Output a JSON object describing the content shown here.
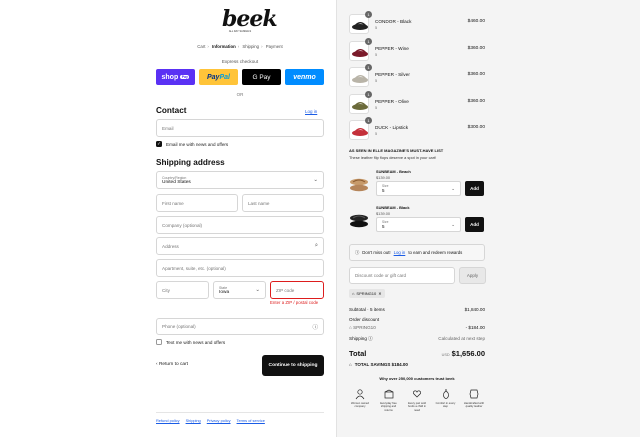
{
  "logo": {
    "text": "beek",
    "sub": "ALL DAY SANDALS"
  },
  "breadcrumbs": [
    "Cart",
    "Information",
    "Shipping",
    "Payment"
  ],
  "express_checkout": "Express checkout",
  "express_buttons": {
    "shop": "shop",
    "shop_pill": "Pay",
    "paypal_a": "Pay",
    "paypal_b": "Pal",
    "gpay": "G Pay",
    "venmo": "venmo"
  },
  "or": "OR",
  "contact": {
    "heading": "Contact",
    "login": "Log in",
    "email_placeholder": "Email",
    "news_label": "Email me with news and offers"
  },
  "shipping": {
    "heading": "Shipping address",
    "country_label": "Country/Region",
    "country_value": "United States",
    "first_name": "First name",
    "last_name": "Last name",
    "company": "Company (optional)",
    "address": "Address",
    "apartment": "Apartment, suite, etc. (optional)",
    "city": "City",
    "state_label": "State",
    "state_value": "Iowa",
    "zip": "ZIP code",
    "zip_error": "Enter a ZIP / postal code",
    "phone": "Phone (optional)",
    "text_label": "Text me with news and offers"
  },
  "actions": {
    "return": "Return to cart",
    "continue": "Continue to shipping"
  },
  "footer": [
    "Refund policy",
    "Shipping",
    "Privacy policy",
    "Terms of service"
  ],
  "cart_items": [
    {
      "name": "CONDOR - Black",
      "size": "5",
      "qty": "1",
      "price": "$460.00",
      "color": "#222222"
    },
    {
      "name": "PEPPER - Wine",
      "size": "5",
      "qty": "1",
      "price": "$360.00",
      "color": "#7a1a2a"
    },
    {
      "name": "PEPPER - Silver",
      "size": "5",
      "qty": "1",
      "price": "$360.00",
      "color": "#b9b4a8"
    },
    {
      "name": "PEPPER - Olive",
      "size": "5",
      "qty": "1",
      "price": "$360.00",
      "color": "#6b6a3a"
    },
    {
      "name": "DUCK - Lipstick",
      "size": "5",
      "qty": "1",
      "price": "$300.00",
      "color": "#c4303a"
    }
  ],
  "promo": {
    "heading": "AS SEEN IN ELLE MAGAZINE'S MUST-HAVE LIST",
    "sub": "These leather flip flops deserve a spot in your cart!"
  },
  "upsells": [
    {
      "name": "SUNBEAM - Beach",
      "price": "$139.00",
      "size_label": "Size",
      "size_value": "5",
      "add": "Add",
      "color": "#c79a6a"
    },
    {
      "name": "SUNBEAM - Black",
      "price": "$139.00",
      "size_label": "Size",
      "size_value": "5",
      "add": "Add",
      "color": "#222222"
    }
  ],
  "rewards": {
    "pre": "Don't miss out!",
    "link": "Log in",
    "post": "to earn and redeem rewards"
  },
  "discount": {
    "placeholder": "Discount code or gift card",
    "apply": "Apply",
    "chip": "SPRING10"
  },
  "summary": {
    "subtotal_label": "Subtotal · 5 items",
    "subtotal_value": "$1,840.00",
    "order_discount": "Order discount",
    "code": "SPRING10",
    "code_value": "- $184.00",
    "shipping_label": "Shipping",
    "shipping_value": "Calculated at next step",
    "total_label": "Total",
    "currency": "USD",
    "total_value": "$1,656.00",
    "savings": "TOTAL SAVINGS  $184.00"
  },
  "trust": {
    "heading": "Why over 250,000 customers trust beek",
    "items": [
      "Women owned company",
      "Everyday free shipping and returns",
      "Every pair sold funds a child in need",
      "Comfort in every step",
      "Handcrafted with quality leather"
    ]
  }
}
